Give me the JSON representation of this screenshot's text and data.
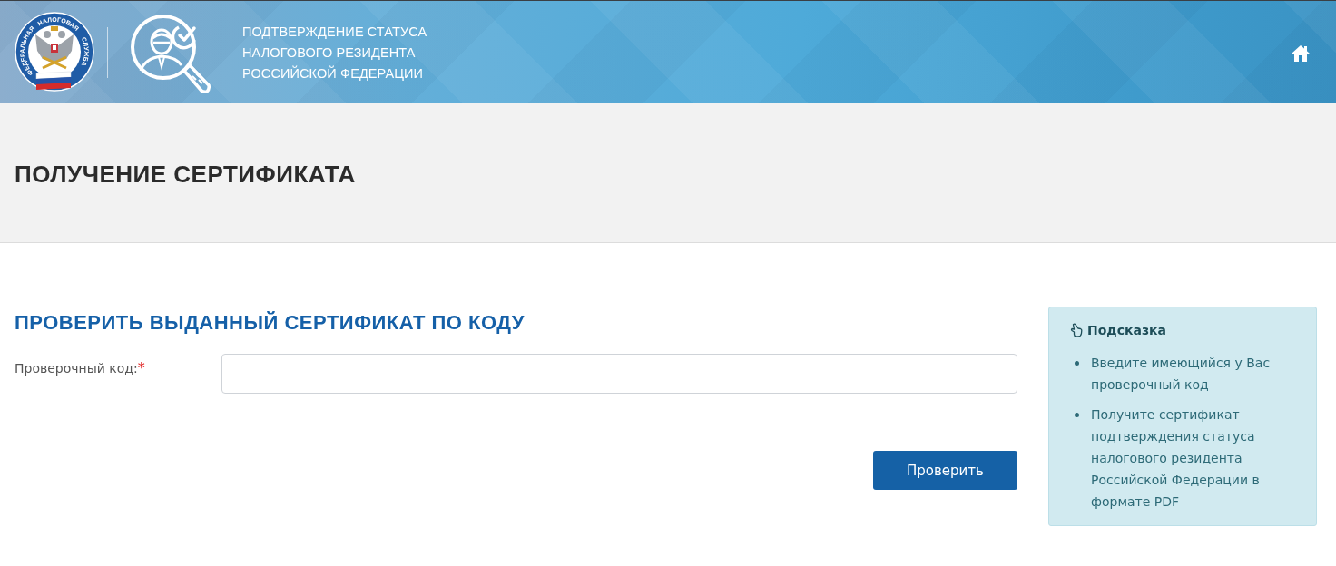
{
  "header": {
    "emblem_words": [
      "ФЕДЕРАЛЬНАЯ",
      "НАЛОГОВАЯ",
      "СЛУЖБА"
    ],
    "title_lines": [
      "ПОДТВЕРЖДЕНИЕ СТАТУСА",
      "НАЛОГОВОГО РЕЗИДЕНТА",
      "РОССИЙСКОЙ ФЕДЕРАЦИИ"
    ]
  },
  "page_title": "ПОЛУЧЕНИЕ СЕРТИФИКАТА",
  "form": {
    "title": "ПРОВЕРИТЬ ВЫДАННЫЙ СЕРТИФИКАТ ПО КОДУ",
    "fields": [
      {
        "kind": "text",
        "label": "Проверочный код:",
        "required_mark": "*"
      }
    ],
    "submit": "Проверить"
  },
  "hint": {
    "title": "Подсказка",
    "items": [
      "Введите имеющийся у Вас проверочный код",
      "Получите сертификат подтверждения статуса налогового резидента Российской Федерации в формате PDF"
    ]
  }
}
